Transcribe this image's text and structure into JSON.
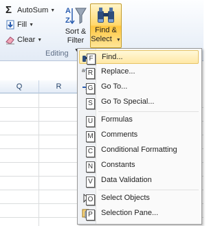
{
  "ribbon": {
    "autosum_label": "AutoSum",
    "fill_label": "Fill",
    "clear_label": "Clear",
    "sort_filter_line1": "Sort &",
    "sort_filter_line2": "Filter",
    "find_select_line1": "Find &",
    "find_select_line2": "Select",
    "group_label": "Editing"
  },
  "grid": {
    "columns": [
      "Q",
      "R"
    ]
  },
  "menu": {
    "items": [
      {
        "label": "Find...",
        "key": "F"
      },
      {
        "label": "Replace...",
        "key": "R"
      },
      {
        "label": "Go To...",
        "key": "G"
      },
      {
        "label": "Go To Special...",
        "key": "S"
      },
      {
        "label": "Formulas",
        "key": "U"
      },
      {
        "label": "Comments",
        "key": "M"
      },
      {
        "label": "Conditional Formatting",
        "key": "C"
      },
      {
        "label": "Constants",
        "key": "N"
      },
      {
        "label": "Data Validation",
        "key": "V"
      },
      {
        "label": "Select Objects",
        "key": "O"
      },
      {
        "label": "Selection Pane...",
        "key": "P"
      }
    ]
  },
  "colors": {
    "highlight": "#ffe8a6",
    "ribbon_bg": "#e3ebf6"
  }
}
